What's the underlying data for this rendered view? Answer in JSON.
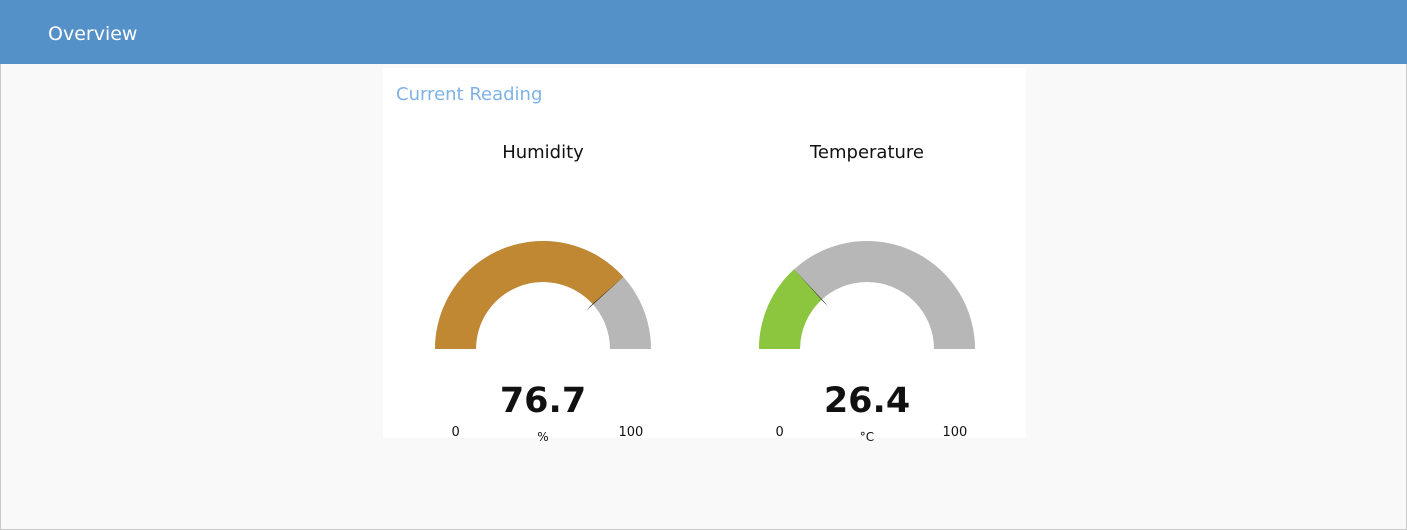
{
  "header": {
    "title": "Overview"
  },
  "card": {
    "title": "Current Reading"
  },
  "gauges": [
    {
      "label": "Humidity",
      "value": 76.7,
      "value_text": "76.7",
      "unit": "%",
      "min": 0,
      "max": 100,
      "min_text": "0",
      "max_text": "100",
      "color": "#c08832"
    },
    {
      "label": "Temperature",
      "value": 26.4,
      "value_text": "26.4",
      "unit": "°C",
      "min": 0,
      "max": 100,
      "min_text": "0",
      "max_text": "100",
      "color": "#8cc63f"
    }
  ],
  "colors": {
    "header_bg": "#5591c9",
    "card_title": "#7eb2e6",
    "track": "#b7b7b7",
    "needle": "#111111"
  }
}
